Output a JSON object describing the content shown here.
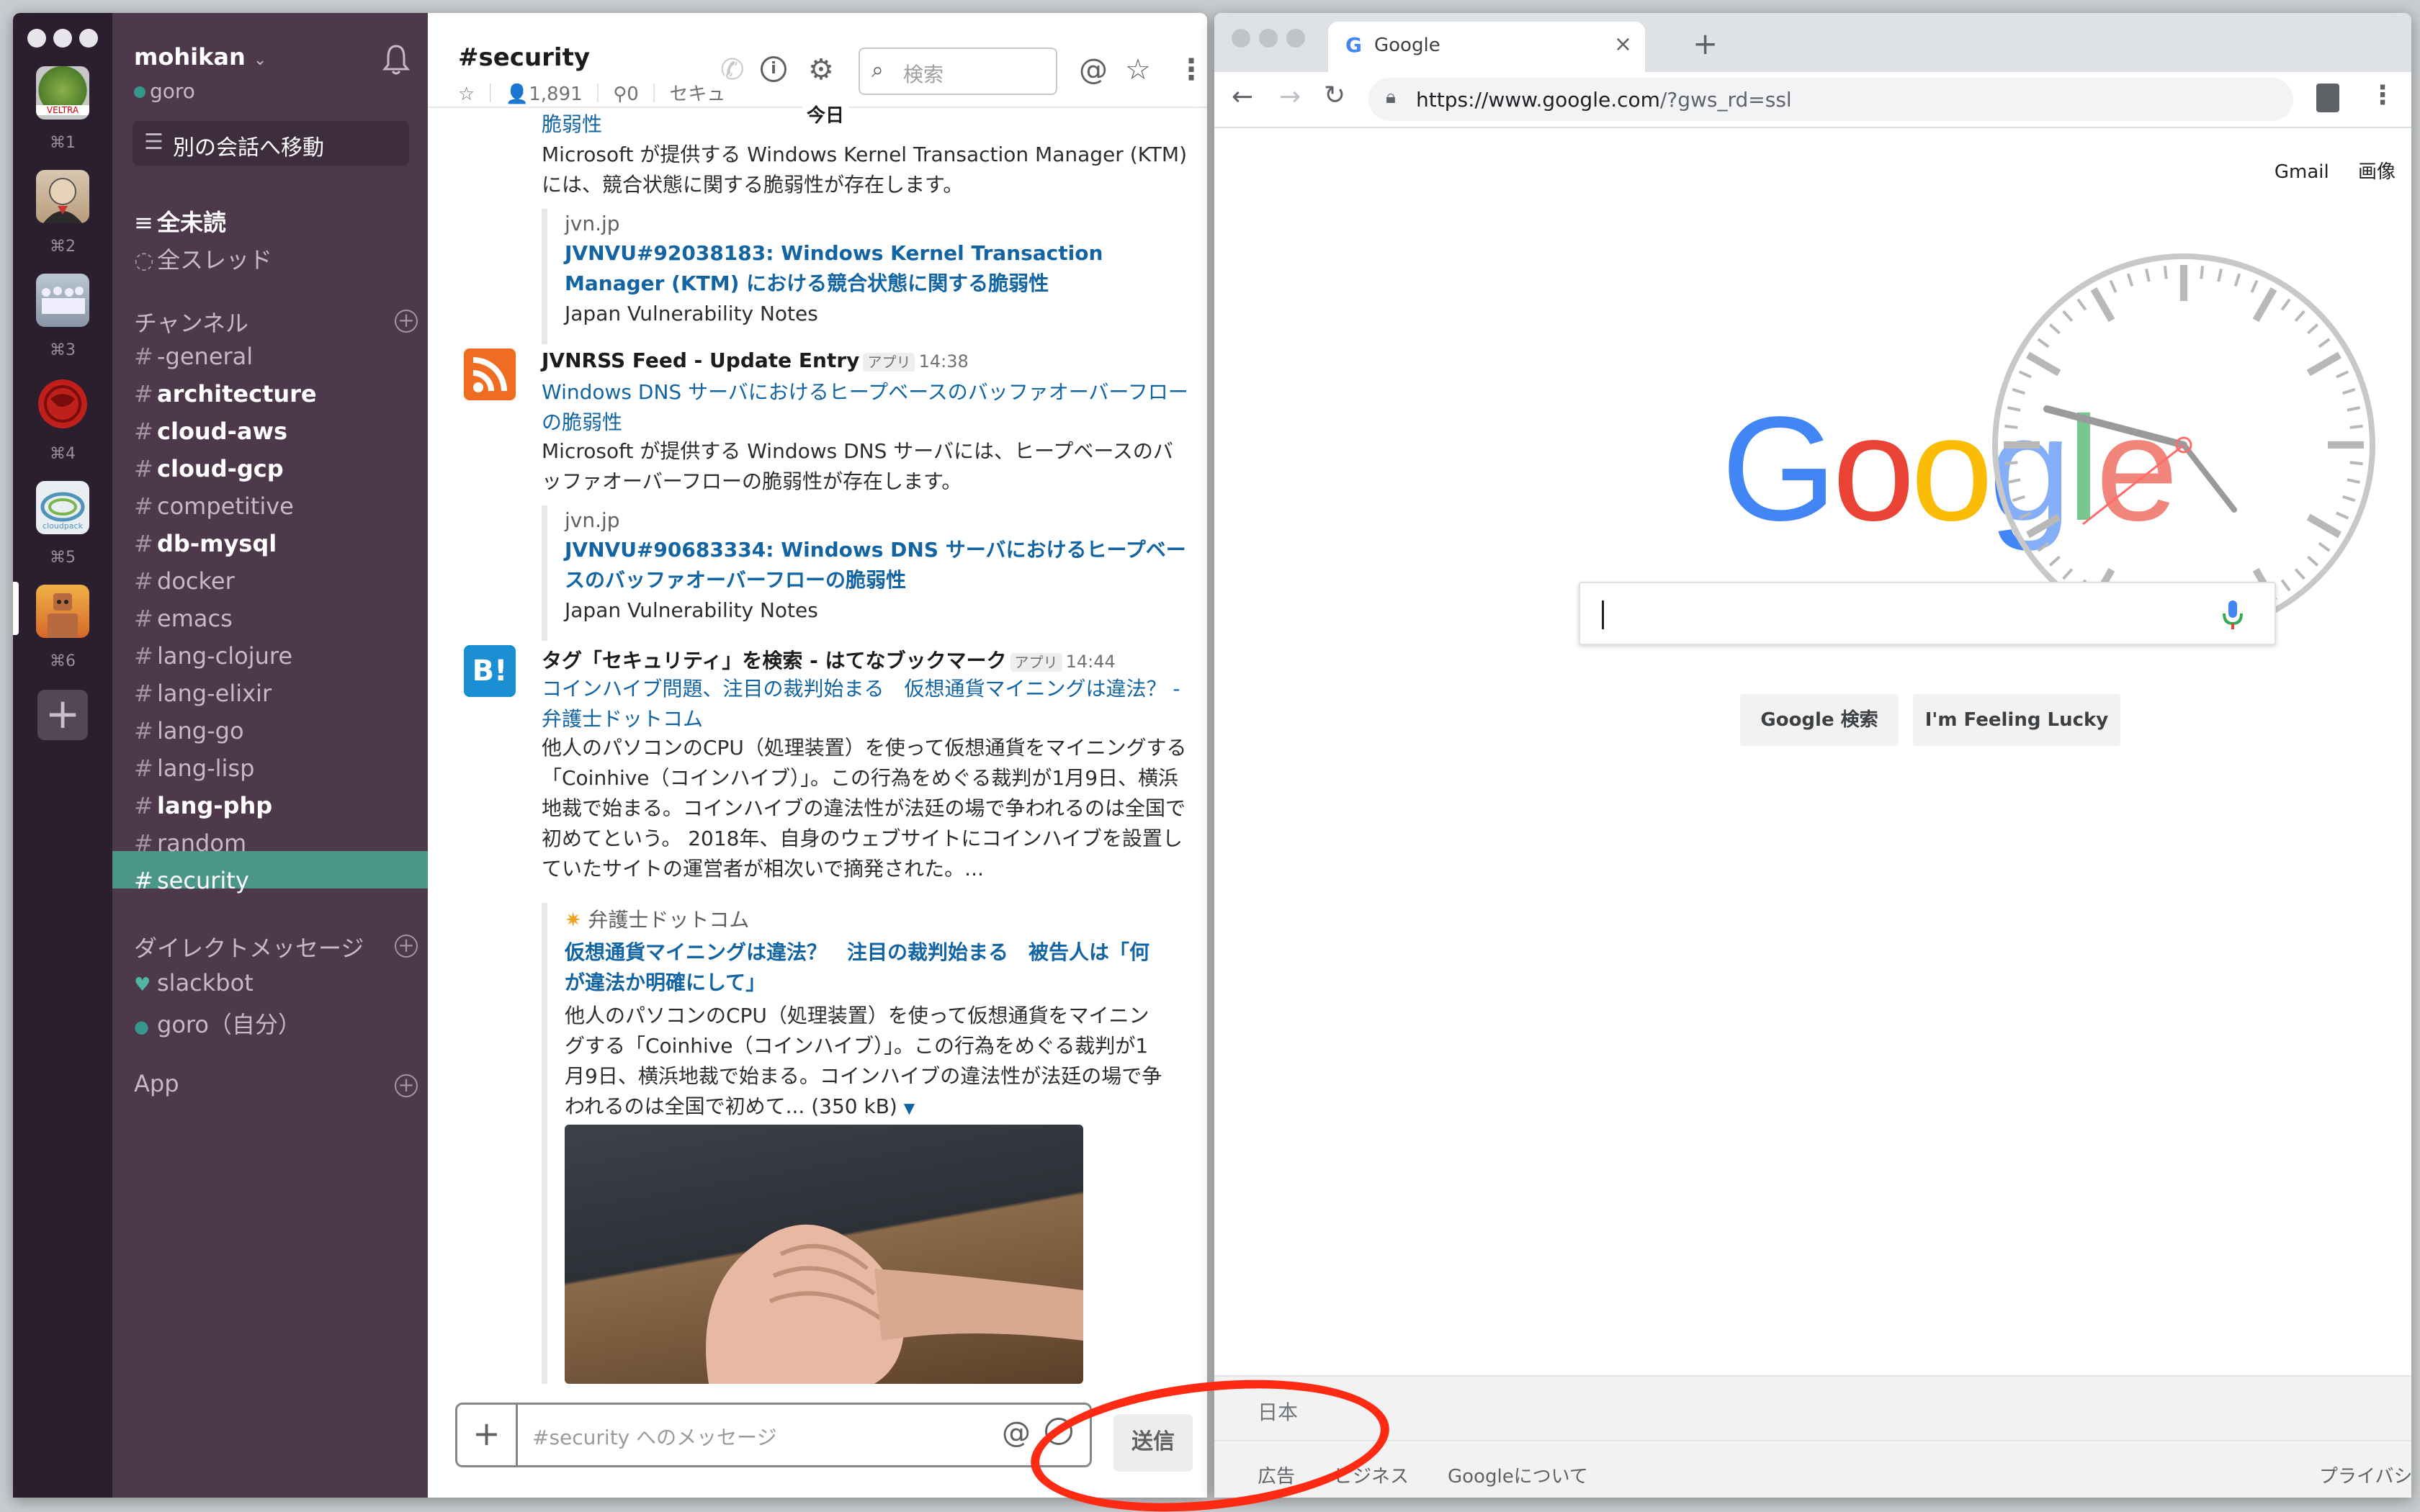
{
  "slack": {
    "teams": [
      {
        "key": "⌘1",
        "name": "VELTRA"
      },
      {
        "key": "⌘2",
        "name": ""
      },
      {
        "key": "⌘3",
        "name": ""
      },
      {
        "key": "⌘4",
        "name": ""
      },
      {
        "key": "⌘5",
        "name": "cloudpack"
      },
      {
        "key": "⌘6",
        "name": ""
      }
    ],
    "workspace_name": "mohikan",
    "user_name": "goro",
    "jump_label": "別の会話へ移動",
    "all_unreads": "全未読",
    "all_threads": "全スレッド",
    "channels_header": "チャンネル",
    "channels": [
      {
        "name": "-general",
        "bold": false
      },
      {
        "name": "architecture",
        "bold": true
      },
      {
        "name": "cloud-aws",
        "bold": true
      },
      {
        "name": "cloud-gcp",
        "bold": true
      },
      {
        "name": "competitive",
        "bold": false
      },
      {
        "name": "db-mysql",
        "bold": true
      },
      {
        "name": "docker",
        "bold": false
      },
      {
        "name": "emacs",
        "bold": false
      },
      {
        "name": "lang-clojure",
        "bold": false
      },
      {
        "name": "lang-elixir",
        "bold": false
      },
      {
        "name": "lang-go",
        "bold": false
      },
      {
        "name": "lang-lisp",
        "bold": false
      },
      {
        "name": "lang-php",
        "bold": true
      },
      {
        "name": "random",
        "bold": false
      },
      {
        "name": "security",
        "bold": false,
        "active": true
      }
    ],
    "dm_header": "ダイレクトメッセージ",
    "dms": [
      {
        "name": "slackbot"
      },
      {
        "name": "goro（自分）"
      }
    ],
    "app_header": "App",
    "channel": {
      "title": "#security",
      "members": "1,891",
      "pins": "0",
      "topic_fragment": "セキュ"
    },
    "search_placeholder": "検索",
    "day_divider": "今日",
    "messages": [
      {
        "partial_top_link": "脆弱性",
        "body": "Microsoft が提供する Windows Kernel Transaction Manager (KTM) には、競合状態に関する脆弱性が存在します。",
        "att_source": "jvn.jp",
        "att_title": "JVNVU#92038183: Windows Kernel Transaction Manager (KTM) における競合状態に関する脆弱性",
        "att_footer": "Japan Vulnerability Notes"
      },
      {
        "sender": "JVNRSS Feed - Update Entry",
        "badge": "アプリ",
        "time": "14:38",
        "link": "Windows DNS サーバにおけるヒープベースのバッファオーバーフローの脆弱性",
        "body": "Microsoft が提供する Windows DNS サーバには、ヒープベースのバッファオーバーフローの脆弱性が存在します。",
        "att_source": "jvn.jp",
        "att_title": "JVNVU#90683334: Windows DNS サーバにおけるヒープベースのバッファオーバーフローの脆弱性",
        "att_footer": "Japan Vulnerability Notes"
      },
      {
        "sender": "タグ「セキュリティ」を検索 - はてなブックマーク",
        "badge": "アプリ",
        "time": "14:44",
        "link": "コインハイブ問題、注目の裁判始まる　仮想通貨マイニングは違法？ - 弁護士ドットコム",
        "body": "他人のパソコンのCPU（処理装置）を使って仮想通貨をマイニングする「Coinhive（コインハイブ）」。この行為をめぐる裁判が1月9日、横浜地裁で始まる。コインハイブの違法性が法廷の場で争われるのは全国で初めてという。 2018年、自身のウェブサイトにコインハイブを設置していたサイトの運営者が相次いで摘発された。...",
        "att_source": "弁護士ドットコム",
        "att_title": "仮想通貨マイニングは違法？　注目の裁判始まる　被告人は「何が違法か明確にして」",
        "att_body": "他人のパソコンのCPU（処理装置）を使って仮想通貨をマイニングする「Coinhive（コインハイブ）」。この行為をめぐる裁判が1月9日、横浜地裁で始まる。コインハイブの違法性が法廷の場で争われるのは全国で初めて...",
        "att_size": "(350 kB)"
      }
    ],
    "composer_placeholder": "#security へのメッセージ",
    "send_label": "送信"
  },
  "chrome": {
    "tab_title": "Google",
    "url_host": "https://www.google.com",
    "url_path": "/?gws_rd=ssl",
    "gmail": "Gmail",
    "images": "画像",
    "logo": "Google",
    "search_button": "Google 検索",
    "lucky_button": "I'm Feeling Lucky",
    "footer_country": "日本",
    "footer_links": [
      "広告",
      "ビジネス",
      "Googleについて"
    ],
    "footer_right": "プライバシー"
  },
  "colors": {
    "slack_sidebar": "#4d394b",
    "slack_rail": "#2a1e2f",
    "slack_active": "#4c9689",
    "link_blue": "#1264a3",
    "annotation_red": "#ff2a14"
  }
}
